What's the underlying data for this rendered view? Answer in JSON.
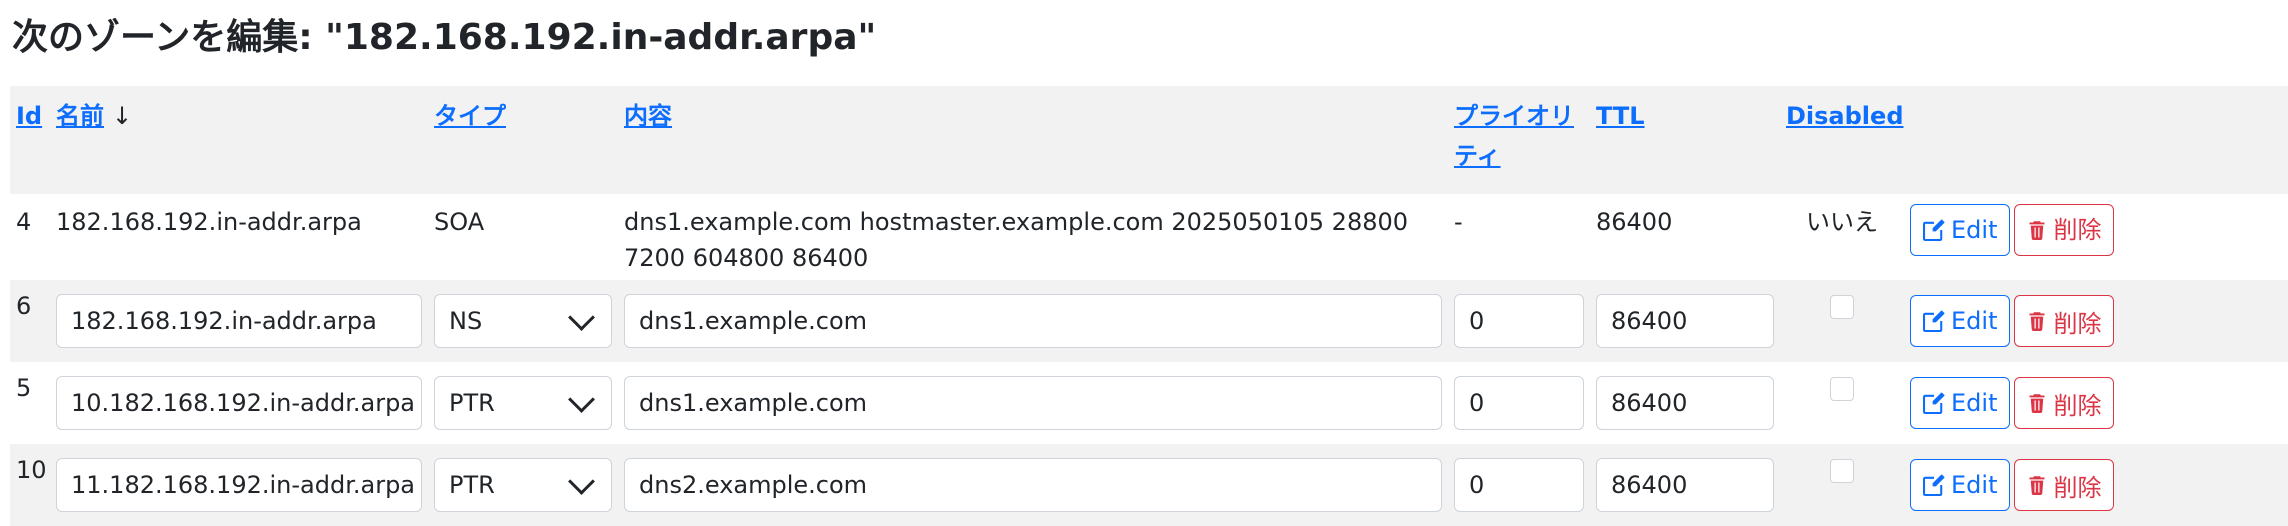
{
  "page": {
    "title": "次のゾーンを編集: \"182.168.192.in-addr.arpa\""
  },
  "table": {
    "headers": {
      "id": "Id",
      "name": "名前",
      "sort_indicator": "↓",
      "type": "タイプ",
      "content": "内容",
      "priority": "プライオリティ",
      "ttl": "TTL",
      "disabled": "Disabled"
    },
    "soa_row": {
      "id": "4",
      "name": "182.168.192.in-addr.arpa",
      "type": "SOA",
      "content": "dns1.example.com hostmaster.example.com 2025050105 28800 7200 604800 86400",
      "priority": "-",
      "ttl": "86400",
      "disabled": "いいえ",
      "edit_label": "Edit",
      "delete_label": "削除"
    },
    "rows": [
      {
        "id": "6",
        "name": "182.168.192.in-addr.arpa",
        "type": "NS",
        "content": "dns1.example.com",
        "priority": "0",
        "ttl": "86400",
        "edit_label": "Edit",
        "delete_label": "削除"
      },
      {
        "id": "5",
        "name": "10.182.168.192.in-addr.arpa",
        "type": "PTR",
        "content": "dns1.example.com",
        "priority": "0",
        "ttl": "86400",
        "edit_label": "Edit",
        "delete_label": "削除"
      },
      {
        "id": "10",
        "name": "11.182.168.192.in-addr.arpa",
        "type": "PTR",
        "content": "dns2.example.com",
        "priority": "0",
        "ttl": "86400",
        "edit_label": "Edit",
        "delete_label": "削除"
      }
    ]
  },
  "colors": {
    "link": "#0d6efd",
    "danger": "#dc3545",
    "stripe": "#f2f2f2"
  },
  "icons": {
    "edit": "edit-icon",
    "delete": "trash-icon",
    "select": "chevron-down-icon"
  }
}
